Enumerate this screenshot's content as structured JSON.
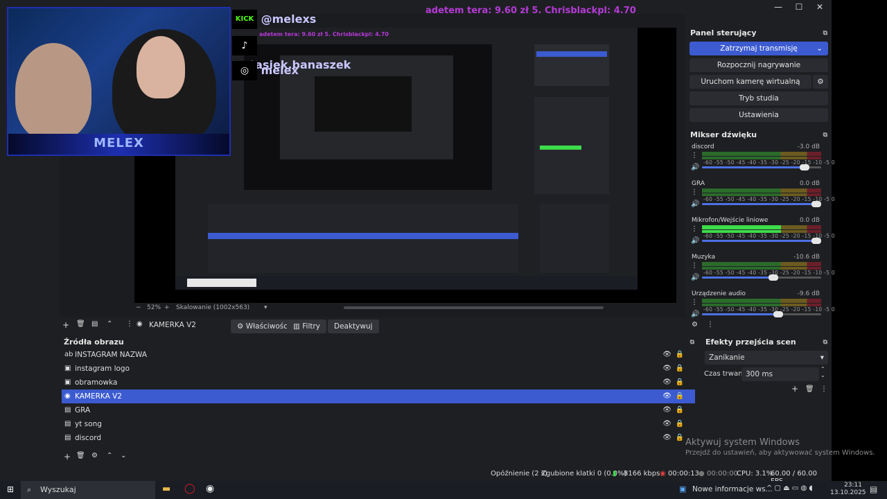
{
  "window": {
    "minimize": "—",
    "maximize": "☐",
    "close": "✕"
  },
  "overlay": {
    "donations": "adetem tera: 9.60 zł    5. Chrisblackpl: 4.70"
  },
  "social": {
    "kick": "@melexs",
    "tiktok": "@stasiek.banaszek",
    "instagram": "melex",
    "kick_badge": "KICK",
    "webcam_name": "MELEX"
  },
  "preview": {
    "zoom": "52%",
    "scaling": "Skalowanie (1002x563)"
  },
  "toolbar": {
    "source_name": "KAMERKA V2",
    "properties": "Właściwości",
    "filters": "Filtry",
    "deactivate": "Deaktywuj"
  },
  "controls": {
    "title": "Panel sterujący",
    "stop_stream": "Zatrzymaj transmisję",
    "start_recording": "Rozpocznij nagrywanie",
    "virtual_cam": "Uruchom kamerę wirtualną",
    "studio_mode": "Tryb studia",
    "settings": "Ustawienia"
  },
  "mixer": {
    "title": "Mikser dźwięku",
    "scale": "-60 -55 -50 -45 -40 -35 -30 -25 -20 -15 -10 -5 0",
    "channels": [
      {
        "name": "discord",
        "db": "-3.0 dB",
        "level": 0.0,
        "volume": 0.86
      },
      {
        "name": "GRA",
        "db": "0.0 dB",
        "level": 0.0,
        "volume": 0.96
      },
      {
        "name": "Mikrofon/Wejście liniowe",
        "db": "0.0 dB",
        "level": 0.66,
        "volume": 0.96
      },
      {
        "name": "Muzyka",
        "db": "-10.6 dB",
        "level": 0.0,
        "volume": 0.6
      },
      {
        "name": "Urządzenie audio",
        "db": "-9.6 dB",
        "level": 0.0,
        "volume": 0.64
      }
    ]
  },
  "sources": {
    "title": "Źródła obrazu",
    "items": [
      {
        "label": "INSTAGRAM NAZWA",
        "icon": "ab"
      },
      {
        "label": "instagram logo",
        "icon": "▣"
      },
      {
        "label": "obramowka",
        "icon": "▣"
      },
      {
        "label": "KAMERKA V2",
        "icon": "◉"
      },
      {
        "label": "GRA",
        "icon": "▤"
      },
      {
        "label": "yt song",
        "icon": "▤"
      },
      {
        "label": "discord",
        "icon": "▤"
      }
    ]
  },
  "transitions": {
    "title": "Efekty przejścia scen",
    "selected": "Zanikanie",
    "duration_label": "Czas trwania",
    "duration_value": "300 ms"
  },
  "activation": {
    "line1": "Aktywuj system Windows",
    "line2": "Przejdź do ustawień, aby aktywować system Windows."
  },
  "status": {
    "delay": "Opóźnienie (2 s)",
    "dropped": "Zgubione klatki 0 (0.0%)",
    "bitrate": "8166 kbps",
    "stream_time": "00:00:13",
    "rec_time": "00:00:00",
    "cpu": "CPU: 3.1%",
    "fps": "60.00 / 60.00 FPS"
  },
  "taskbar": {
    "search": "Wyszukaj",
    "news": "Nowe informacje ws...",
    "time": "23:11",
    "date": "13.10.2025"
  }
}
